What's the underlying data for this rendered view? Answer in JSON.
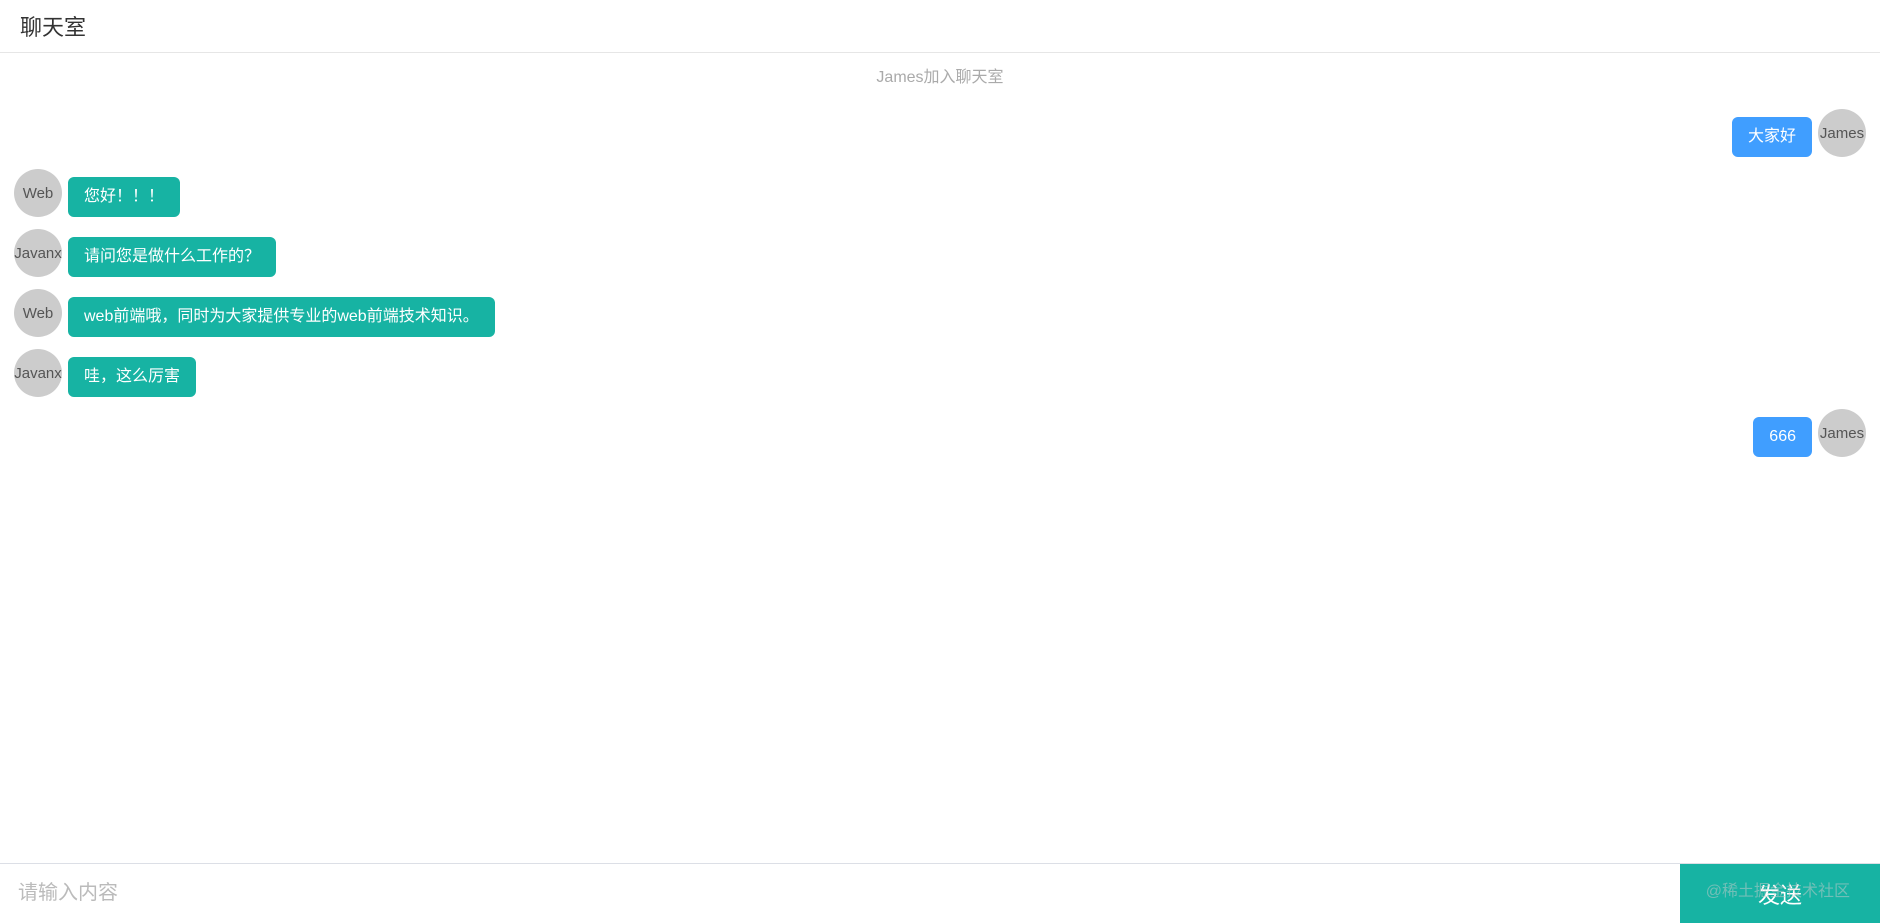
{
  "header": {
    "title": "聊天室"
  },
  "system_message": "James加入聊天室",
  "messages": [
    {
      "user": "James",
      "text": "大家好",
      "self": true
    },
    {
      "user": "Web",
      "text": "您好！！！",
      "self": false
    },
    {
      "user": "Javanx",
      "text": "请问您是做什么工作的？",
      "self": false
    },
    {
      "user": "Web",
      "text": "web前端哦，同时为大家提供专业的web前端技术知识。",
      "self": false
    },
    {
      "user": "Javanx",
      "text": "哇，这么厉害",
      "self": false
    },
    {
      "user": "James",
      "text": "666",
      "self": true
    }
  ],
  "input": {
    "placeholder": "请输入内容",
    "send_label": "发送"
  },
  "watermark": "@稀土掘金技术社区"
}
